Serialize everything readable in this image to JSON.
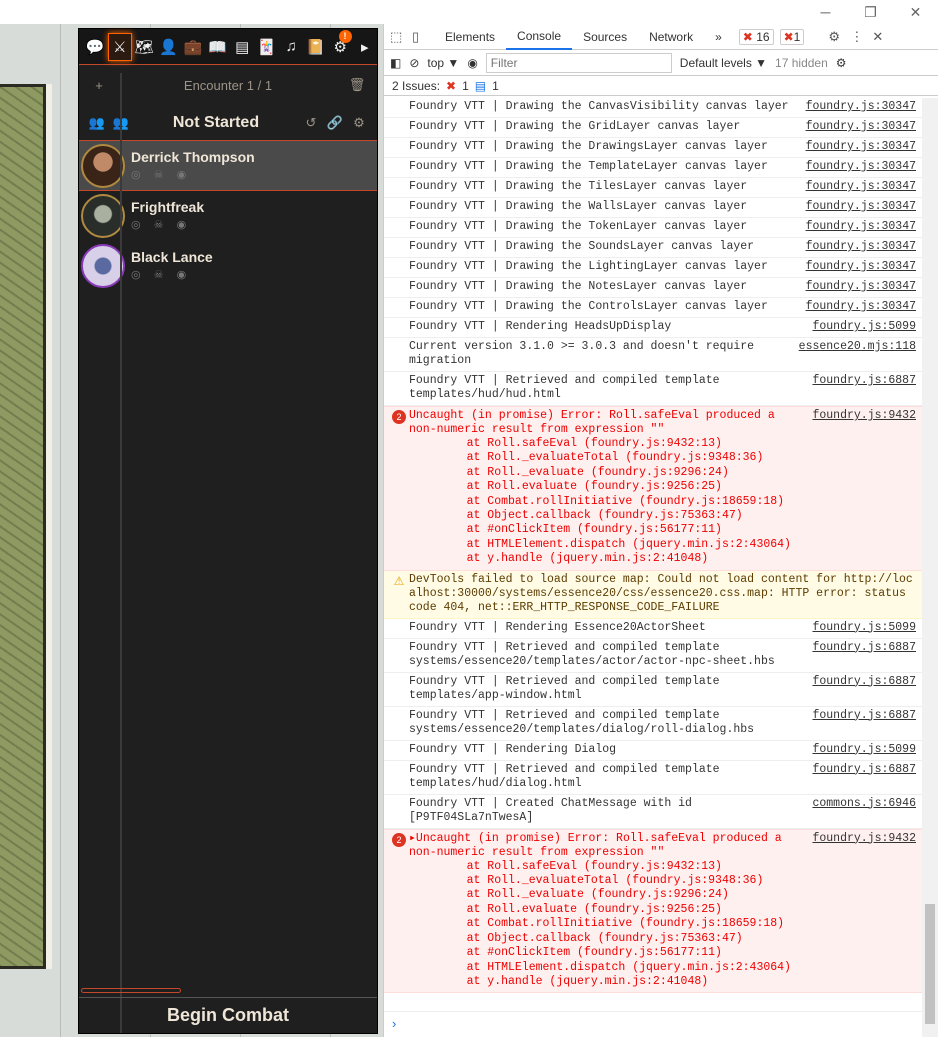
{
  "window": {
    "minimize": "─",
    "restore": "❐",
    "close": "✕"
  },
  "tracker": {
    "tabs": [
      "💬",
      "⚔",
      "🗺",
      "👤",
      "💼",
      "📖",
      "▤",
      "🃏",
      "♫",
      "📔",
      "⚙",
      "▸"
    ],
    "notification_badge": "!",
    "encounter_label": "Encounter 1 / 1",
    "state_title": "Not Started",
    "combatants": [
      {
        "name": "Derrick Thompson",
        "icons": "◎ ☠ ◉"
      },
      {
        "name": "Frightfreak",
        "icons": "◎ ☠ ◉"
      },
      {
        "name": "Black Lance",
        "icons": "◎ ☠ ◉"
      }
    ],
    "begin_label": "Begin Combat"
  },
  "devtools": {
    "tabs": [
      "Elements",
      "Console",
      "Sources",
      "Network",
      "»"
    ],
    "error_count": "16",
    "warning_count": "1",
    "context": "top ▼",
    "filter_placeholder": "Filter",
    "levels": "Default levels ▼",
    "hidden": "17 hidden",
    "issues_label": "2 Issues:",
    "issues_err": "1",
    "issues_info": "1",
    "logs": [
      {
        "m": "Foundry VTT | Drawing the CanvasVisibility canvas layer",
        "s": "foundry.js:30347"
      },
      {
        "m": "Foundry VTT | Drawing the GridLayer canvas layer",
        "s": "foundry.js:30347"
      },
      {
        "m": "Foundry VTT | Drawing the DrawingsLayer canvas layer",
        "s": "foundry.js:30347"
      },
      {
        "m": "Foundry VTT | Drawing the TemplateLayer canvas layer",
        "s": "foundry.js:30347"
      },
      {
        "m": "Foundry VTT | Drawing the TilesLayer canvas layer",
        "s": "foundry.js:30347"
      },
      {
        "m": "Foundry VTT | Drawing the WallsLayer canvas layer",
        "s": "foundry.js:30347"
      },
      {
        "m": "Foundry VTT | Drawing the TokenLayer canvas layer",
        "s": "foundry.js:30347"
      },
      {
        "m": "Foundry VTT | Drawing the SoundsLayer canvas layer",
        "s": "foundry.js:30347"
      },
      {
        "m": "Foundry VTT | Drawing the LightingLayer canvas layer",
        "s": "foundry.js:30347"
      },
      {
        "m": "Foundry VTT | Drawing the NotesLayer canvas layer",
        "s": "foundry.js:30347"
      },
      {
        "m": "Foundry VTT | Drawing the ControlsLayer canvas layer",
        "s": "foundry.js:30347"
      },
      {
        "m": "Foundry VTT | Rendering HeadsUpDisplay",
        "s": "foundry.js:5099"
      },
      {
        "m": "Current version 3.1.0 >= 3.0.3 and doesn't require\nmigration",
        "s": "essence20.mjs:118"
      },
      {
        "m": "Foundry VTT | Retrieved and compiled template\ntemplates/hud/hud.html",
        "s": "foundry.js:6887"
      }
    ],
    "error1": {
      "m": "Uncaught (in promise) Error: Roll.safeEval produced a\nnon-numeric result from expression \"\"",
      "s": "foundry.js:9432",
      "count": "2"
    },
    "stack": "    at Roll.safeEval (foundry.js:9432:13)\n    at Roll._evaluateTotal (foundry.js:9348:36)\n    at Roll._evaluate (foundry.js:9296:24)\n    at Roll.evaluate (foundry.js:9256:25)\n    at Combat.rollInitiative (foundry.js:18659:18)\n    at Object.callback (foundry.js:75363:47)\n    at #onClickItem (foundry.js:56177:11)\n    at HTMLElement.dispatch (jquery.min.js:2:43064)\n    at y.handle (jquery.min.js:2:41048)",
    "warning": "DevTools failed to load source map: Could not load content for http://localhost:30000/systems/essence20/css/essence20.css.map: HTTP error: status code 404, net::ERR_HTTP_RESPONSE_CODE_FAILURE",
    "logs2": [
      {
        "m": "Foundry VTT | Rendering Essence20ActorSheet",
        "s": "foundry.js:5099"
      },
      {
        "m": "Foundry VTT | Retrieved and compiled template\nsystems/essence20/templates/actor/actor-npc-sheet.hbs",
        "s": "foundry.js:6887"
      },
      {
        "m": "Foundry VTT | Retrieved and compiled template\ntemplates/app-window.html",
        "s": "foundry.js:6887"
      },
      {
        "m": "Foundry VTT | Retrieved and compiled template\nsystems/essence20/templates/dialog/roll-dialog.hbs",
        "s": "foundry.js:6887"
      },
      {
        "m": "Foundry VTT | Rendering Dialog",
        "s": "foundry.js:5099"
      },
      {
        "m": "Foundry VTT | Retrieved and compiled template\ntemplates/hud/dialog.html",
        "s": "foundry.js:6887"
      },
      {
        "m": "Foundry VTT | Created ChatMessage with id\n[P9TF04SLa7nTwesA]",
        "s": "commons.js:6946"
      }
    ],
    "error2": {
      "m": "▸Uncaught (in promise) Error: Roll.safeEval produced a\nnon-numeric result from expression \"\"",
      "s": "foundry.js:9432",
      "count": "2"
    },
    "prompt": "›"
  }
}
